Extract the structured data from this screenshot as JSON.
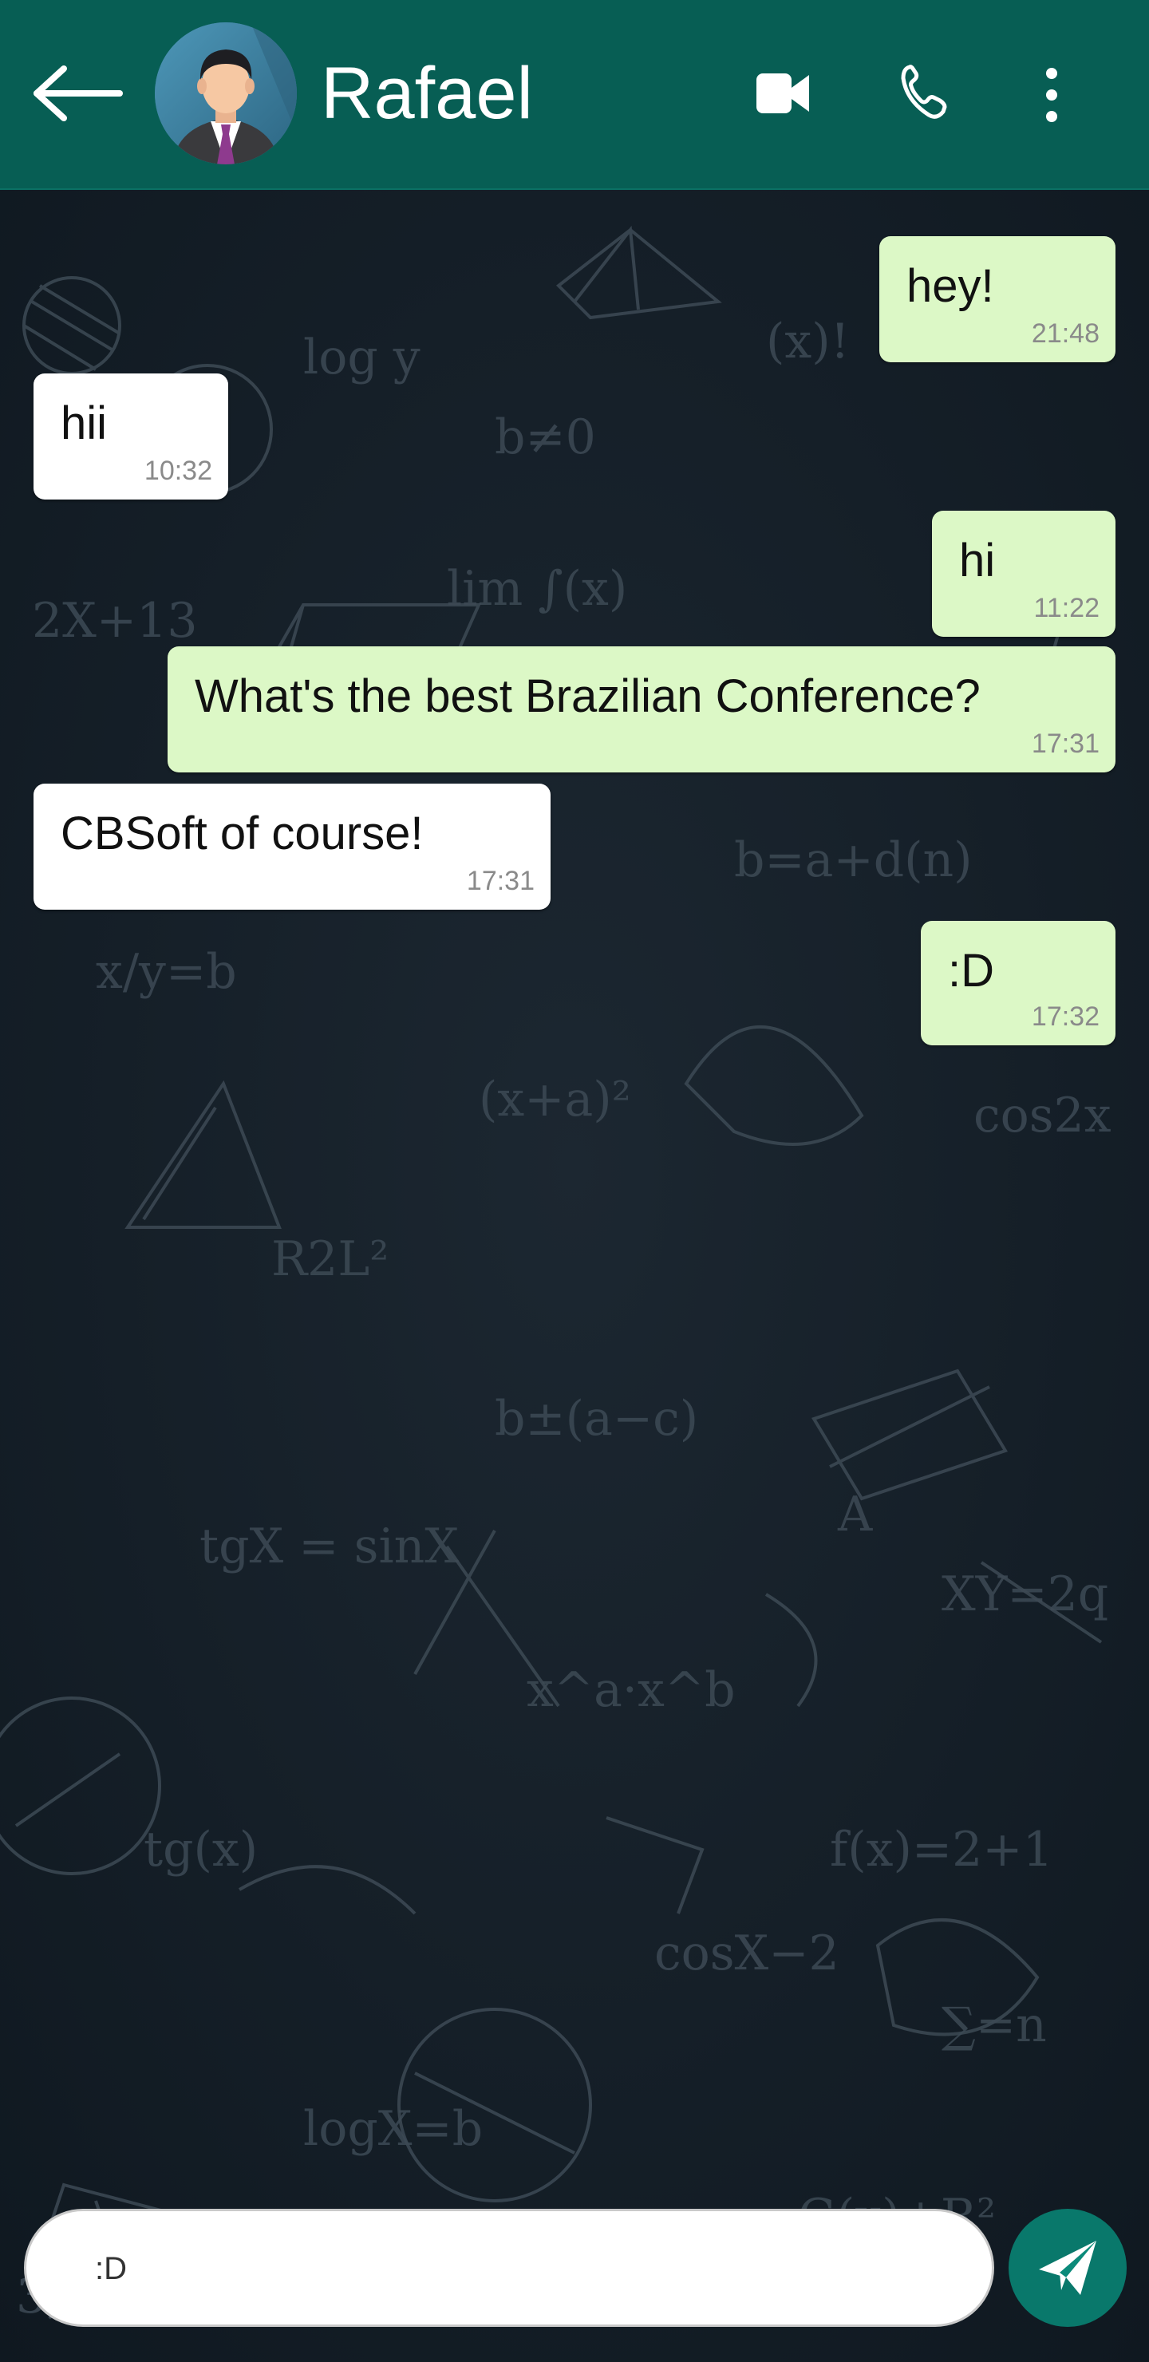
{
  "header": {
    "contact_name": "Rafael",
    "back_icon": "arrow-left-icon",
    "video_icon": "video-camera-icon",
    "call_icon": "phone-icon",
    "menu_icon": "more-vertical-icon"
  },
  "messages": [
    {
      "direction": "out",
      "text": "hey!",
      "time": "21:48"
    },
    {
      "direction": "in",
      "text": "hii",
      "time": "10:32"
    },
    {
      "direction": "out",
      "text": "hi",
      "time": "11:22"
    },
    {
      "direction": "out",
      "text": "What's the best Brazilian Conference?",
      "time": "17:31"
    },
    {
      "direction": "in",
      "text": "CBSoft of course!",
      "time": "17:31"
    },
    {
      "direction": "out",
      "text": ":D",
      "time": "17:32"
    }
  ],
  "composer": {
    "value": ":D",
    "send_icon": "send-icon"
  },
  "colors": {
    "header": "#075e54",
    "outgoing_bubble": "#dcf8c6",
    "incoming_bubble": "#ffffff",
    "send_button": "#09786b",
    "chat_background": "#141d26"
  }
}
